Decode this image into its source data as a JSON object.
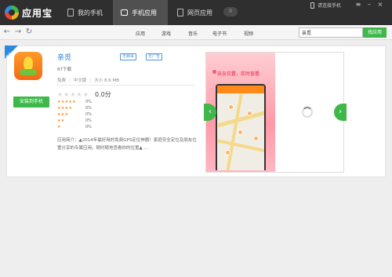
{
  "app": {
    "name": "应用宝"
  },
  "tabs": [
    {
      "label": "我的手机",
      "icon": "phone-icon"
    },
    {
      "label": "手机应用",
      "icon": "app-bag-icon"
    },
    {
      "label": "网页应用",
      "icon": "web-icon"
    }
  ],
  "tab_count": "0",
  "connect_label": "请连接手机",
  "toolbar": {
    "categories": [
      "应用",
      "游戏",
      "音乐",
      "电子书",
      "视频"
    ],
    "search_value": "亲觅",
    "search_button": "找应用"
  },
  "detail": {
    "ribbon": "官方",
    "title": "亲觅",
    "badges": [
      "无病毒",
      "无广告"
    ],
    "downloads": "87下载",
    "meta": [
      "免费",
      "中文版",
      "大小 8.6 MB"
    ],
    "score": "0.0分",
    "install_button": "安装到手机",
    "ratings": [
      {
        "stars": "★★★★★",
        "pct": "0%"
      },
      {
        "stars": "★★★★",
        "pct": "0%"
      },
      {
        "stars": "★★★",
        "pct": "0%"
      },
      {
        "stars": "★★",
        "pct": "0%"
      },
      {
        "stars": "★",
        "pct": "0%"
      }
    ],
    "description": "应用简介：▲2014年最好用的免费GPS定位神器！家庭安全定位及朋友位置分享的专属应用。随时随地查看你的位置▲ ..."
  },
  "gallery": {
    "promo": "亲友位置，实时查看"
  },
  "colors": {
    "accent": "#3fb84a",
    "link": "#2a7fd0",
    "titlebar": "#2f2f2f"
  }
}
